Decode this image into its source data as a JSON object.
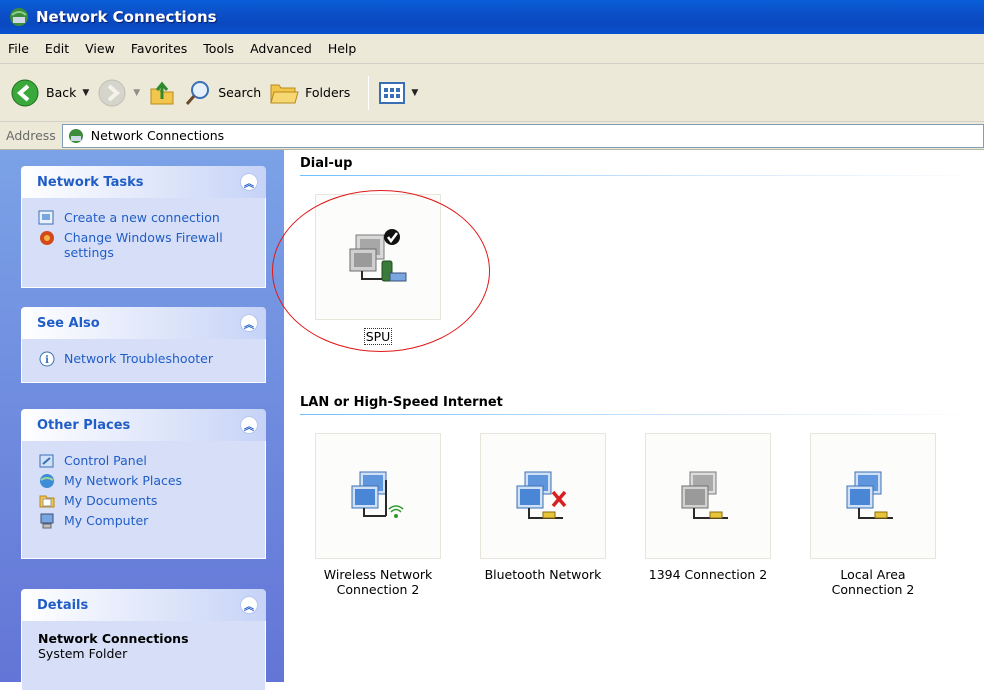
{
  "window": {
    "title": "Network Connections"
  },
  "menu": [
    "File",
    "Edit",
    "View",
    "Favorites",
    "Tools",
    "Advanced",
    "Help"
  ],
  "toolbar": {
    "back_label": "Back",
    "search_label": "Search",
    "folders_label": "Folders"
  },
  "address": {
    "label": "Address",
    "value": "Network Connections"
  },
  "sidebar": {
    "network_tasks": {
      "title": "Network Tasks",
      "items": [
        "Create a new connection",
        "Change Windows Firewall settings"
      ]
    },
    "see_also": {
      "title": "See Also",
      "items": [
        "Network Troubleshooter"
      ]
    },
    "other_places": {
      "title": "Other Places",
      "items": [
        "Control Panel",
        "My Network Places",
        "My Documents",
        "My Computer"
      ]
    },
    "details": {
      "title": "Details",
      "name": "Network Connections",
      "type": "System Folder"
    }
  },
  "groups": {
    "dialup": {
      "title": "Dial-up",
      "items": [
        "SPU"
      ]
    },
    "lan": {
      "title": "LAN or High-Speed Internet",
      "items": [
        "Wireless Network Connection 2",
        "Bluetooth Network",
        "1394 Connection 2",
        "Local Area Connection 2"
      ]
    }
  },
  "colors": {
    "title_bar": "#0a52cf",
    "task_link": "#215dc6",
    "annotation_circle": "#e01818"
  }
}
